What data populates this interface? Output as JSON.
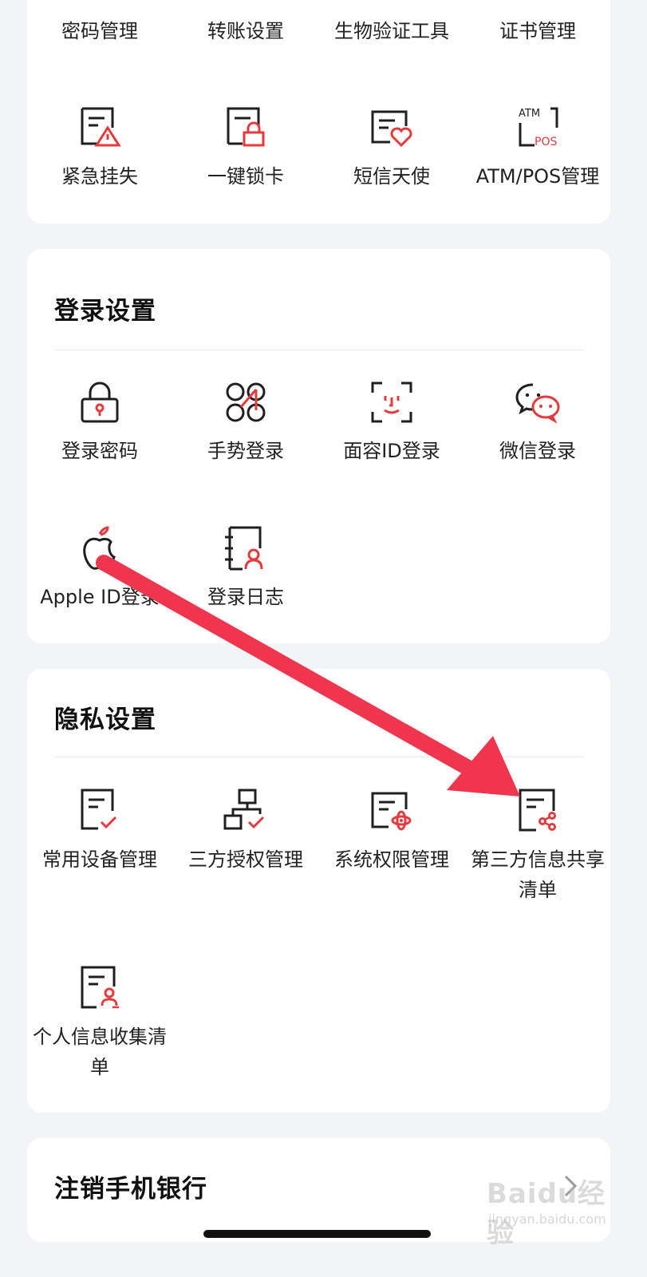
{
  "security_tools": {
    "row1": [
      {
        "label": "密码管理"
      },
      {
        "label": "转账设置"
      },
      {
        "label": "生物验证工具"
      },
      {
        "label": "证书管理"
      }
    ],
    "row2": [
      {
        "label": "紧急挂失",
        "icon": "doc-warning-icon"
      },
      {
        "label": "一键锁卡",
        "icon": "doc-lock-icon"
      },
      {
        "label": "短信天使",
        "icon": "doc-heart-icon"
      },
      {
        "label": "ATM/POS管理",
        "icon": "atm-pos-icon",
        "icon_text_top": "ATM",
        "icon_text_bottom": "POS"
      }
    ]
  },
  "login_settings": {
    "title": "登录设置",
    "items": [
      {
        "label": "登录密码",
        "icon": "padlock-icon"
      },
      {
        "label": "手势登录",
        "icon": "gesture-icon"
      },
      {
        "label": "面容ID登录",
        "icon": "face-id-icon"
      },
      {
        "label": "微信登录",
        "icon": "wechat-icon"
      },
      {
        "label": "Apple ID登录",
        "icon": "apple-icon"
      },
      {
        "label": "登录日志",
        "icon": "login-log-icon"
      }
    ]
  },
  "privacy_settings": {
    "title": "隐私设置",
    "items": [
      {
        "label": "常用设备管理",
        "icon": "device-check-icon"
      },
      {
        "label": "三方授权管理",
        "icon": "authorization-icon"
      },
      {
        "label": "系统权限管理",
        "icon": "system-permission-icon"
      },
      {
        "label": "第三方信息共享清单",
        "icon": "share-list-icon"
      },
      {
        "label": "个人信息收集清单",
        "icon": "personal-info-icon"
      }
    ]
  },
  "account": {
    "cancel_label": "注销手机银行"
  },
  "watermark": {
    "brand": "Baidu经验",
    "sub": "jingyan.baidu.com"
  },
  "colors": {
    "accent_red": "#e8393c",
    "icon_dark": "#1f1f1f",
    "arrow": "#f0364e",
    "page_bg": "#f3f4f6",
    "card_bg": "#ffffff"
  }
}
